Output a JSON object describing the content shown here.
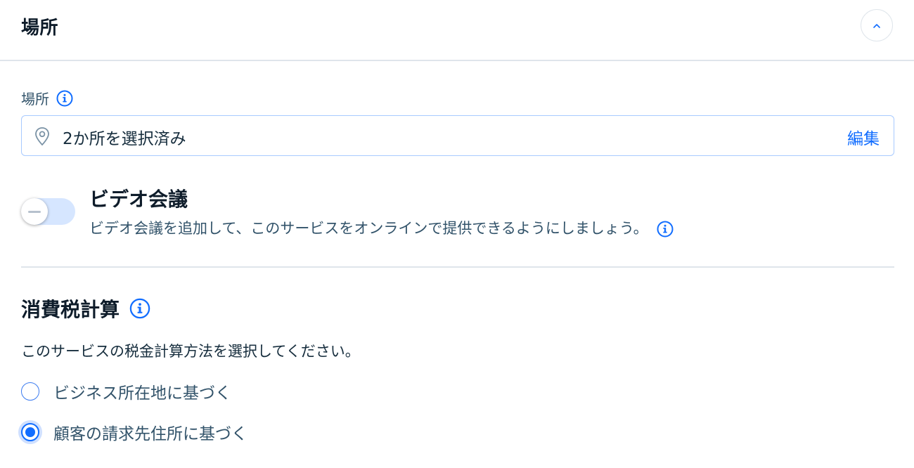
{
  "header": {
    "title": "場所"
  },
  "location": {
    "label": "場所",
    "value": "2か所を選択済み",
    "edit_label": "編集"
  },
  "video": {
    "title": "ビデオ会議",
    "description": "ビデオ会議を追加して、このサービスをオンラインで提供できるようにしましょう。",
    "enabled": false
  },
  "tax": {
    "title": "消費税計算",
    "description": "このサービスの税金計算方法を選択してください。",
    "options": [
      {
        "label": "ビジネス所在地に基づく",
        "selected": false
      },
      {
        "label": "顧客の請求先住所に基づく",
        "selected": true
      }
    ]
  },
  "colors": {
    "accent": "#116dff",
    "text": "#162d3d",
    "divider": "#dfe5eb"
  },
  "icons": {
    "collapse": "chevron-up-icon",
    "info": "info-icon",
    "location": "map-pin-icon"
  }
}
